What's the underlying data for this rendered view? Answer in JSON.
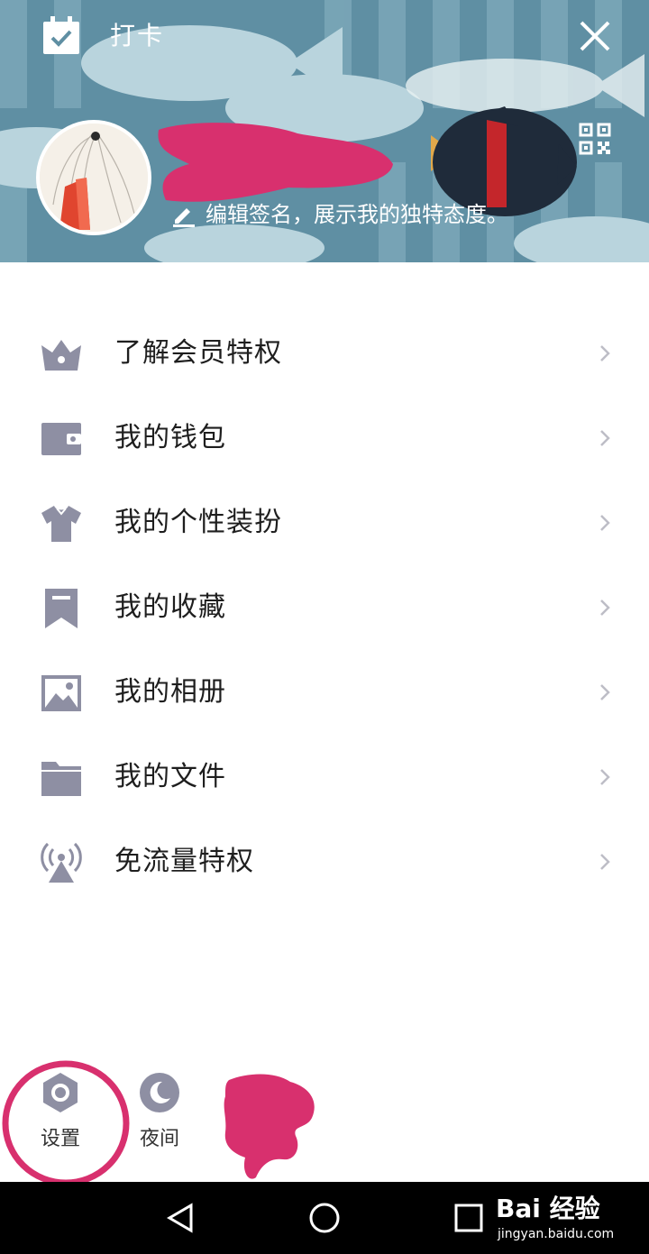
{
  "header": {
    "checkin_label": "打卡",
    "signature_text": "编辑签名，展示我的独特态度。",
    "close_icon": "close-icon",
    "qr_icon": "qr-code-icon"
  },
  "menu": {
    "items": [
      {
        "label": "了解会员特权",
        "icon": "crown-icon"
      },
      {
        "label": "我的钱包",
        "icon": "wallet-icon"
      },
      {
        "label": "我的个性装扮",
        "icon": "tshirt-icon"
      },
      {
        "label": "我的收藏",
        "icon": "bookmark-icon"
      },
      {
        "label": "我的相册",
        "icon": "image-icon"
      },
      {
        "label": "我的文件",
        "icon": "folder-icon"
      },
      {
        "label": "免流量特权",
        "icon": "antenna-icon"
      }
    ]
  },
  "bottom": {
    "settings_label": "设置",
    "night_label": "夜间"
  },
  "watermark": {
    "title": "Bai 经验",
    "subtitle": "jingyan.baidu.com"
  },
  "colors": {
    "header_bg": "#5f8fa3",
    "icon_gray": "#8e8fa3",
    "annotation_pink": "#d8306e"
  }
}
